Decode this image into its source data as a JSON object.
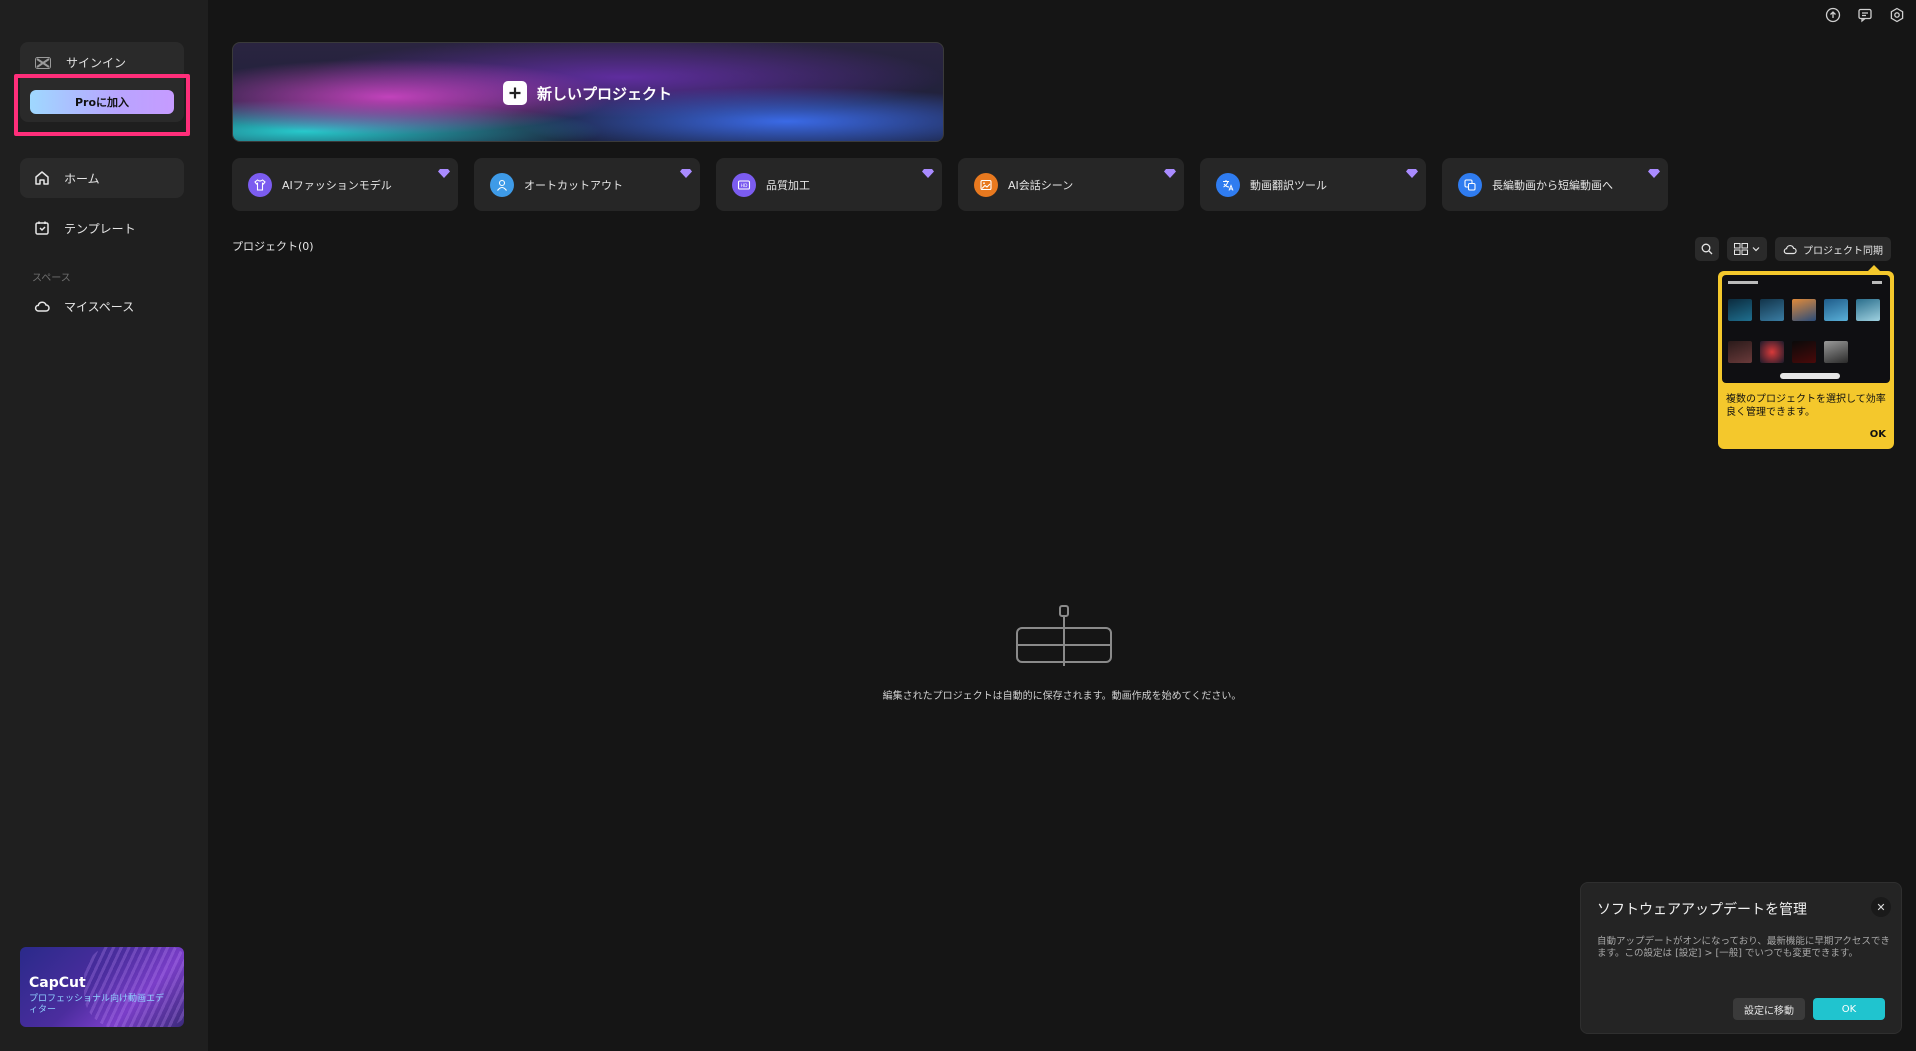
{
  "sidebar": {
    "sign_in_label": "サインイン",
    "pro_button_label": "Proに加入",
    "nav": [
      {
        "label": "ホーム",
        "icon": "home-icon"
      },
      {
        "label": "テンプレート",
        "icon": "template-icon"
      }
    ],
    "section_label": "スペース",
    "space_item": {
      "label": "マイスペース",
      "icon": "cloud-icon"
    },
    "promo": {
      "title": "CapCut",
      "subtitle": "プロフェッショナル向け動画エディター"
    }
  },
  "top_icons": [
    "upload-icon",
    "feedback-icon",
    "settings-icon"
  ],
  "main": {
    "new_project_label": "新しいプロジェクト",
    "tools": [
      {
        "label": "AIファッションモデル",
        "icon": "shirt-icon",
        "color": "#7b5cf0"
      },
      {
        "label": "オートカットアウト",
        "icon": "person-icon",
        "color": "#3e9be8"
      },
      {
        "label": "品質加工",
        "icon": "hd-icon",
        "color": "#7b5cf0"
      },
      {
        "label": "AI会話シーン",
        "icon": "image-icon",
        "color": "#e8791f"
      },
      {
        "label": "動画翻訳ツール",
        "icon": "translate-icon",
        "color": "#2f7cf0"
      },
      {
        "label": "長編動画から短編動画へ",
        "icon": "clip-icon",
        "color": "#2f7cf0"
      }
    ],
    "projects_title": "プロジェクト(0)",
    "sync_label": "プロジェクト同期",
    "empty_text": "編集されたプロジェクトは自動的に保存されます。動画作成を始めてください。"
  },
  "tooltip": {
    "text": "複数のプロジェクトを選択して効率良く管理できます。",
    "ok": "OK"
  },
  "update_dialog": {
    "title": "ソフトウェアアップデートを管理",
    "body": "自動アップデートがオンになっており、最新機能に早期アクセスできます。この設定は [設定] > [一般] でいつでも変更できます。",
    "settings_button": "設定に移動",
    "ok_button": "OK"
  },
  "colors": {
    "accent": "#20c4cf",
    "highlight": "#ff2e7a",
    "tooltip_bg": "#f4c82c",
    "gem": "#a98bff"
  }
}
